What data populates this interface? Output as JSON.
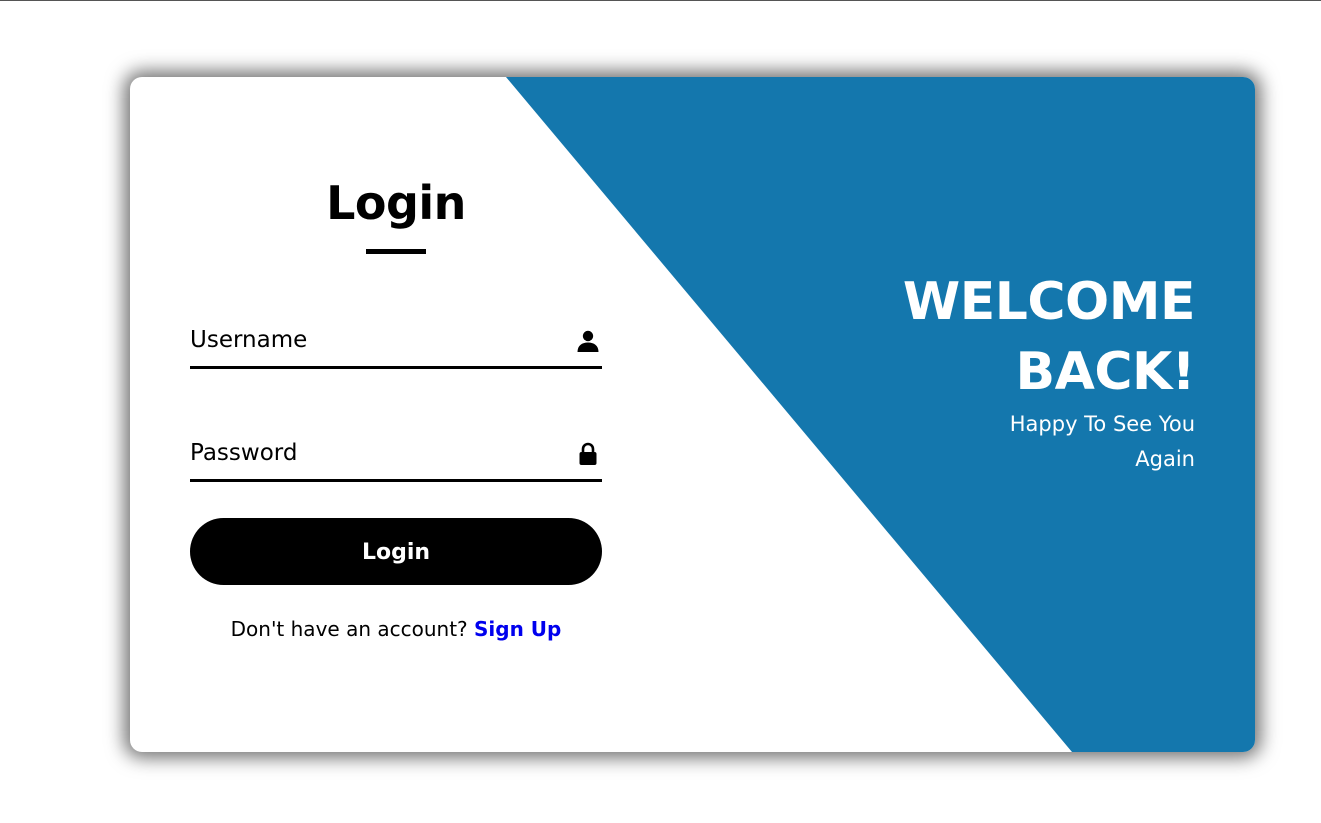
{
  "colors": {
    "accent": "#1477ad",
    "button": "#000000",
    "link": "#0000ee",
    "card": "#ffffff"
  },
  "login": {
    "title": "Login",
    "username_placeholder": "Username",
    "username_icon": "user-icon",
    "password_placeholder": "Password",
    "password_icon": "lock-icon",
    "button_label": "Login",
    "signup_prompt": "Don't have an account?",
    "signup_link": "Sign Up"
  },
  "welcome": {
    "line1": "WELCOME",
    "line2": "BACK!",
    "subtitle_line1": "Happy To See You",
    "subtitle_line2": "Again"
  }
}
